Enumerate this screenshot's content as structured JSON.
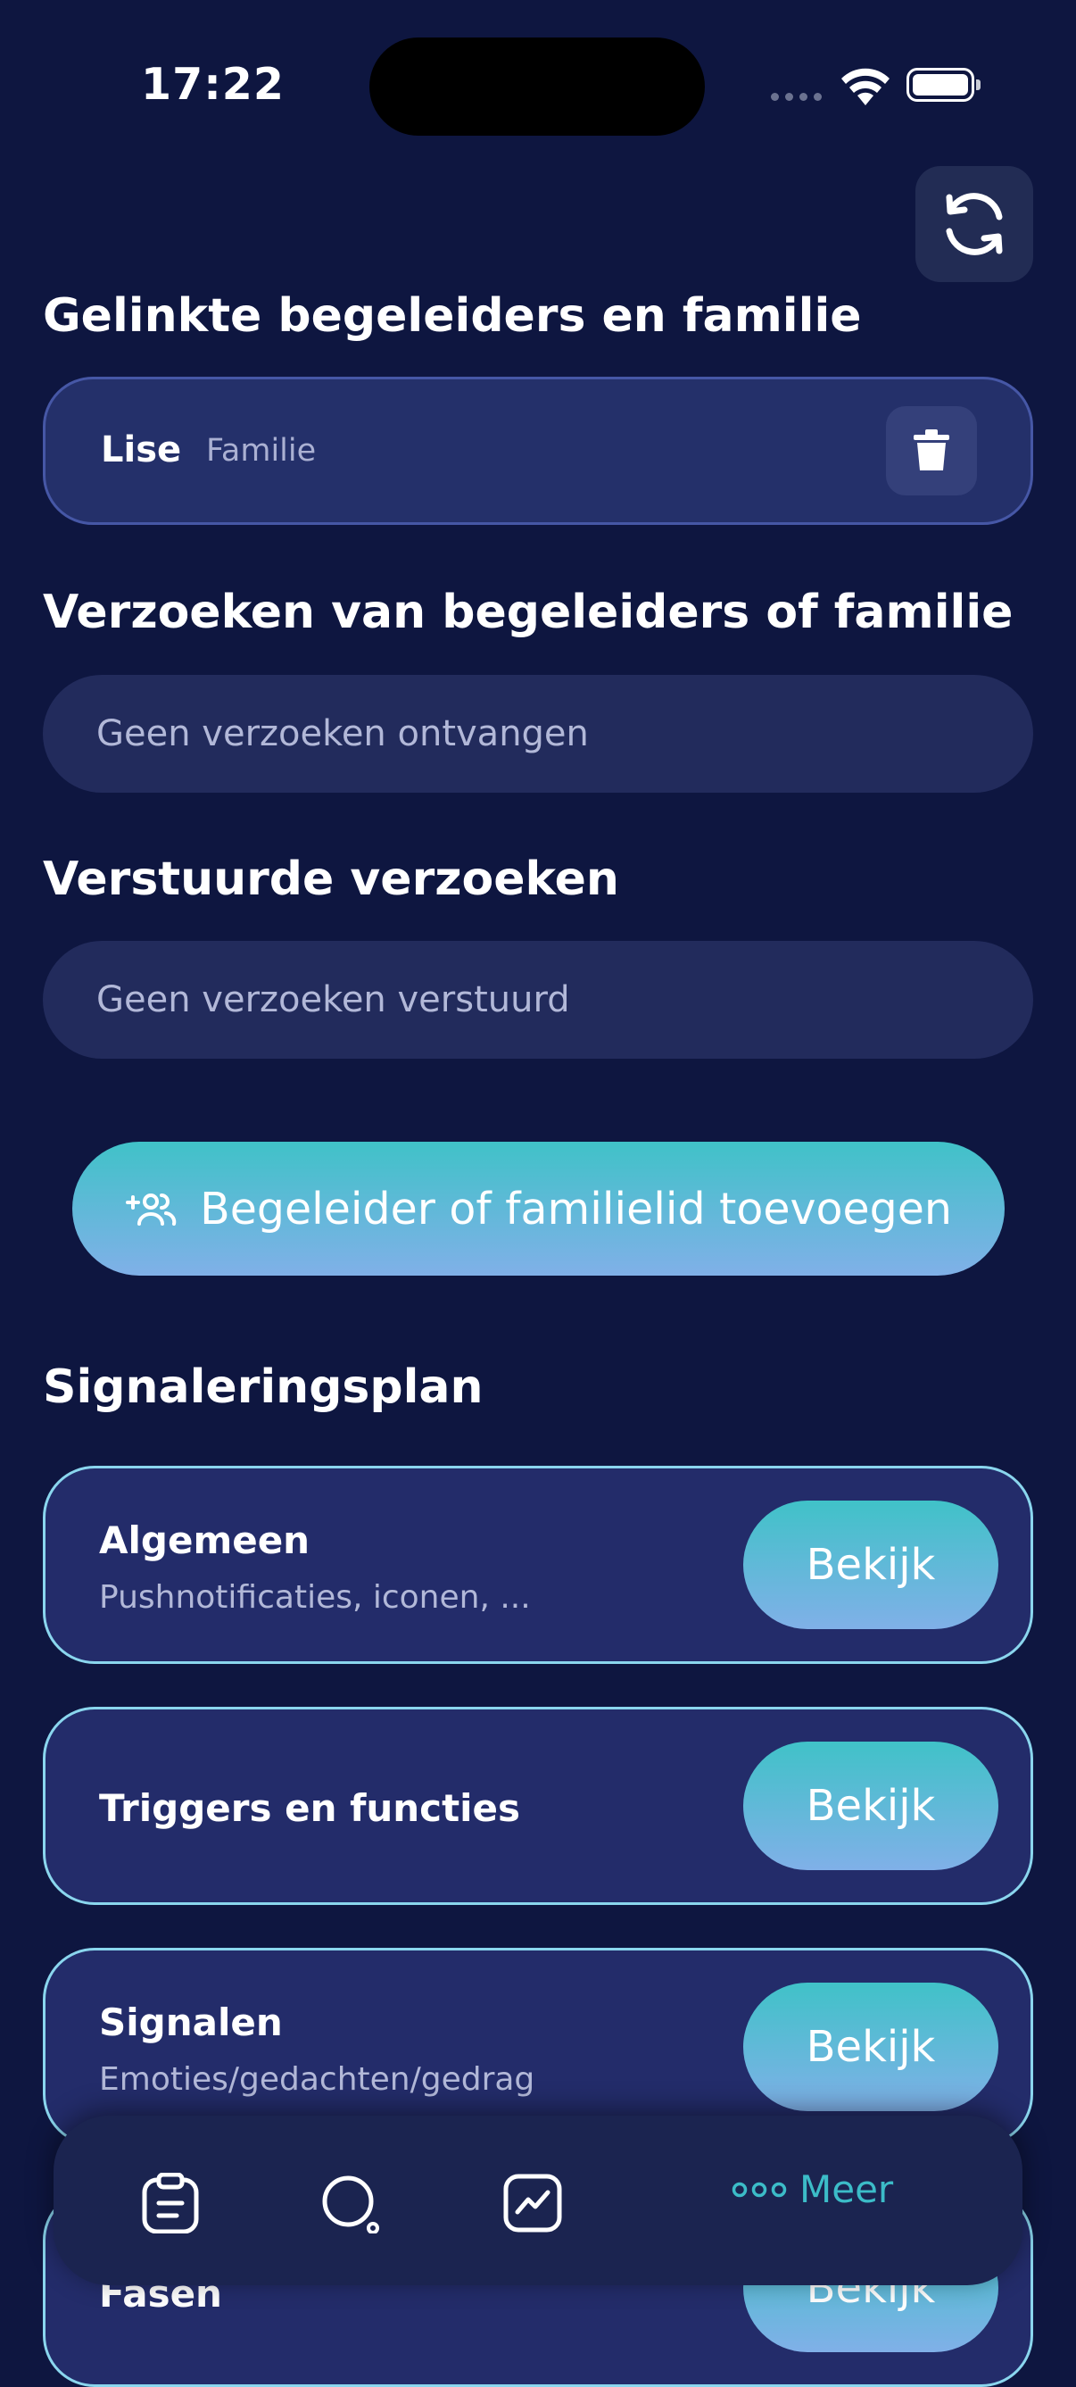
{
  "status_bar": {
    "time": "17:22"
  },
  "sections": {
    "linked_title": "Gelinkte begeleiders en familie",
    "requests_title": "Verzoeken van begeleiders of familie",
    "sent_title": "Verstuurde verzoeken",
    "plan_title": "Signaleringsplan"
  },
  "linked": [
    {
      "name": "Lise",
      "role": "Familie"
    }
  ],
  "requests": {
    "empty_text": "Geen verzoeken ontvangen"
  },
  "sent": {
    "empty_text": "Geen verzoeken verstuurd"
  },
  "add_button": {
    "label": "Begeleider of familielid toevoegen"
  },
  "plan_items": [
    {
      "title": "Algemeen",
      "subtitle": "Pushnotificaties, iconen, ...",
      "button": "Bekijk"
    },
    {
      "title": "Triggers en functies",
      "subtitle": "",
      "button": "Bekijk"
    },
    {
      "title": "Signalen",
      "subtitle": "Emoties/gedachten/gedrag",
      "button": "Bekijk"
    },
    {
      "title": "Fasen",
      "subtitle": "",
      "button": "Bekijk"
    }
  ],
  "tab_bar": {
    "more_label": "Meer",
    "icons": [
      "clipboard-icon",
      "search-icon",
      "chart-icon",
      "more-icon"
    ]
  },
  "colors": {
    "background": "#0e1640",
    "card": "#24306a",
    "accent_teal": "#40c2c8",
    "accent_blue": "#80b0e8",
    "more_tab": "#3cbcc8"
  }
}
